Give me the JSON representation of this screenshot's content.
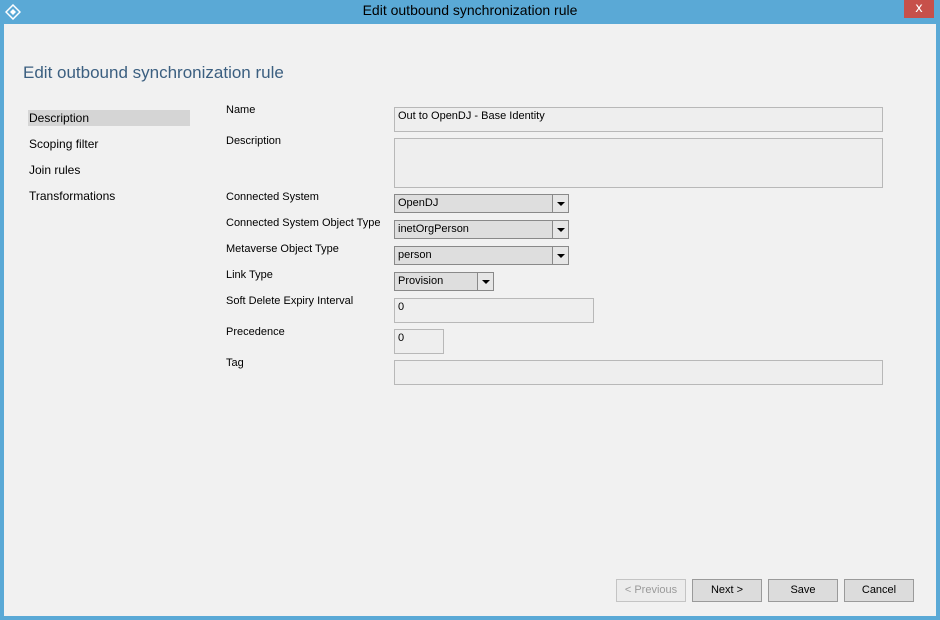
{
  "window": {
    "title": "Edit outbound synchronization rule",
    "close_glyph": "x"
  },
  "page": {
    "heading": "Edit outbound synchronization rule"
  },
  "nav": {
    "items": [
      {
        "label": "Description",
        "selected": true
      },
      {
        "label": "Scoping filter",
        "selected": false
      },
      {
        "label": "Join rules",
        "selected": false
      },
      {
        "label": "Transformations",
        "selected": false
      }
    ]
  },
  "form": {
    "name": {
      "label": "Name",
      "value": "Out to OpenDJ - Base Identity"
    },
    "description": {
      "label": "Description",
      "value": ""
    },
    "connected_system": {
      "label": "Connected System",
      "value": "OpenDJ"
    },
    "connected_system_object_type": {
      "label": "Connected System Object Type",
      "value": "inetOrgPerson"
    },
    "metaverse_object_type": {
      "label": "Metaverse Object Type",
      "value": "person"
    },
    "link_type": {
      "label": "Link Type",
      "value": "Provision"
    },
    "soft_delete_expiry_interval": {
      "label": "Soft Delete Expiry Interval",
      "value": "0"
    },
    "precedence": {
      "label": "Precedence",
      "value": "0"
    },
    "tag": {
      "label": "Tag",
      "value": ""
    }
  },
  "buttons": {
    "previous": "< Previous",
    "next": "Next >",
    "save": "Save",
    "cancel": "Cancel"
  },
  "colors": {
    "title_bar": "#5aa9d6",
    "heading": "#3b5f80",
    "close": "#c7504a"
  }
}
